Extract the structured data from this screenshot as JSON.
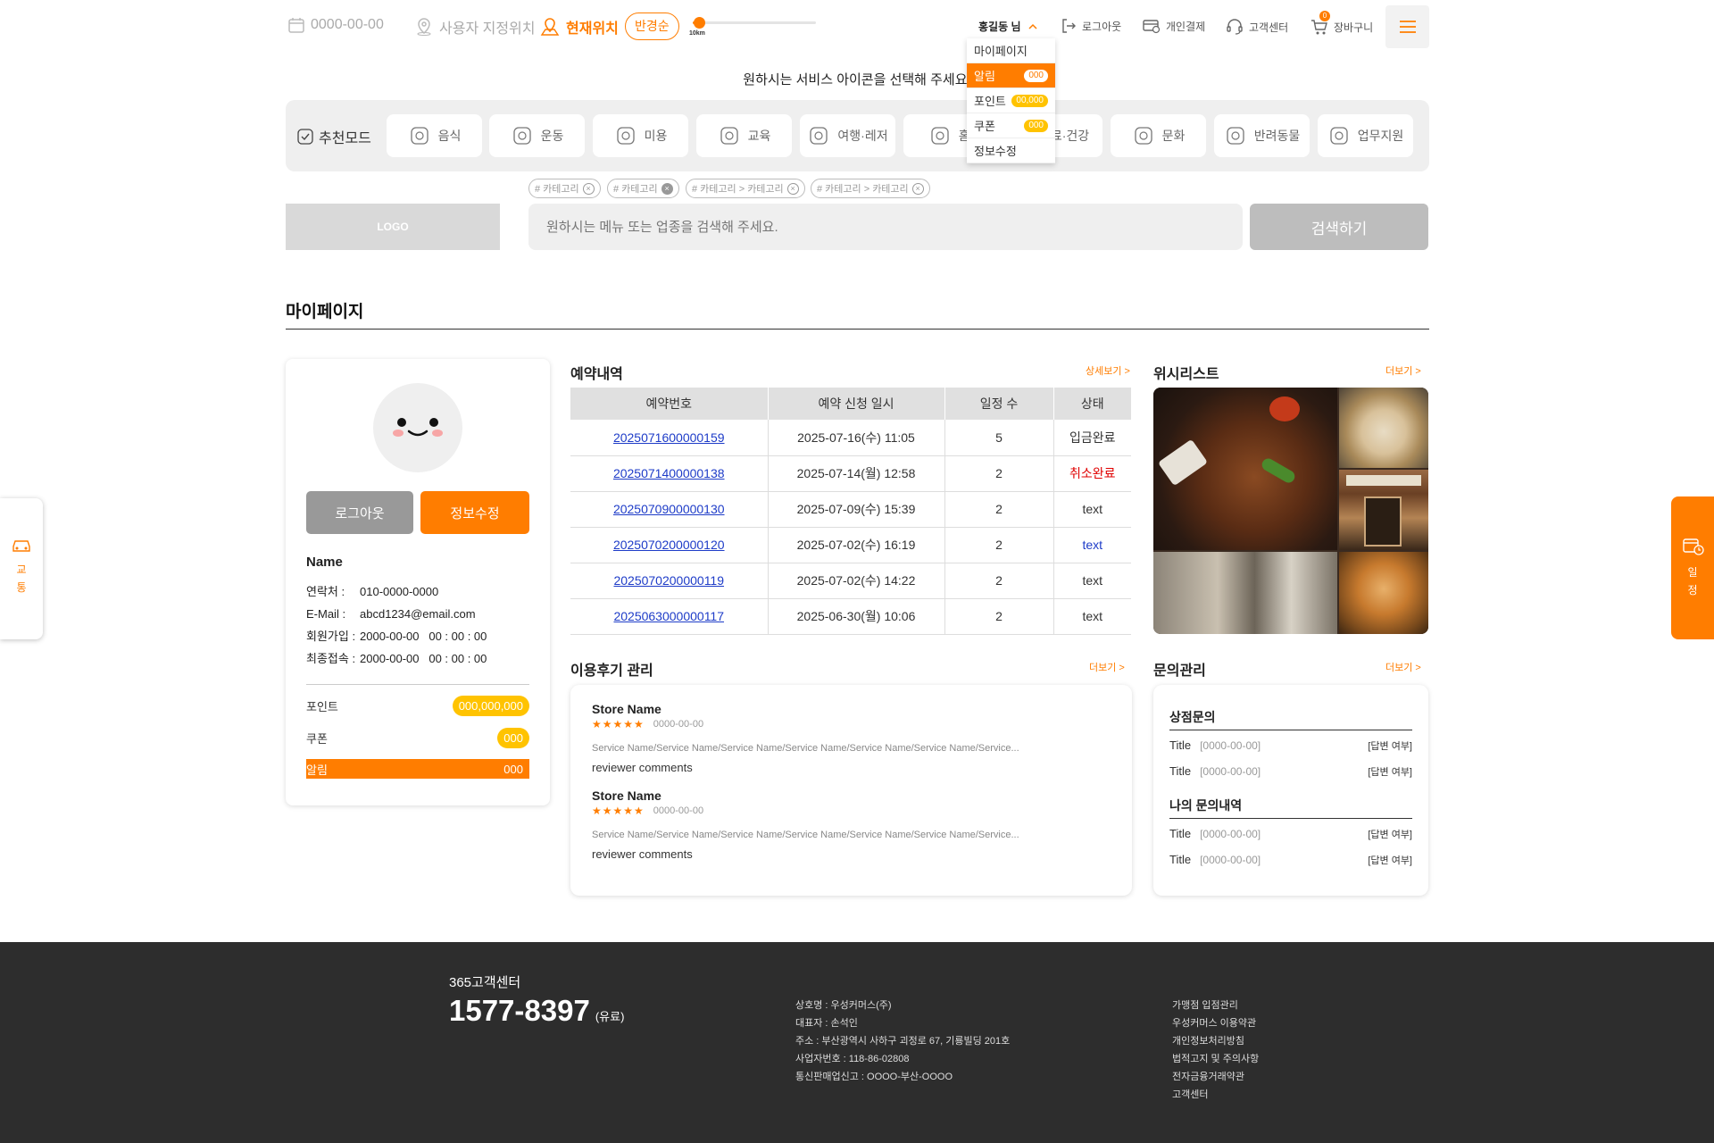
{
  "header": {
    "date_placeholder": "0000-00-00",
    "custom_location": "사용자 지정위치",
    "current_location": "현재위치",
    "radius_button": "반경순",
    "slider_label": "10km",
    "slider_value_fraction": 0.05,
    "user_name": "홍길동 님",
    "logout": "로그아웃",
    "personal_payment": "개인결제",
    "customer_center": "고객센터",
    "cart": "장바구니",
    "cart_count": "0"
  },
  "user_menu": [
    {
      "label": "마이페이지",
      "badge": ""
    },
    {
      "label": "알림",
      "badge": "000"
    },
    {
      "label": "포인트",
      "badge": "00,000"
    },
    {
      "label": "쿠폰",
      "badge": "000"
    },
    {
      "label": "정보수정",
      "badge": ""
    }
  ],
  "prompt": "원하시는 서비스 아이콘을 선택해 주세요.",
  "categories": {
    "mode_label": "추천모드",
    "items": [
      "음식",
      "운동",
      "미용",
      "교육",
      "여행·레저",
      "홈서비스",
      "의료·건강",
      "문화",
      "반려동물",
      "업무지원"
    ],
    "items_visible": [
      "음식",
      "운동",
      "미용",
      "교육",
      "여행·레저",
      "홈·",
      "료·건강",
      "문화",
      "반려동물",
      "업무지원"
    ]
  },
  "tags": [
    "# 카테고리",
    "# 카테고리",
    "# 카테고리 > 카테고리",
    "# 카테고리 > 카테고리"
  ],
  "search": {
    "logo": "LOGO",
    "placeholder": "원하시는 메뉴 또는 업종을 검색해 주세요.",
    "button": "검색하기"
  },
  "page_title": "마이페이지",
  "profile": {
    "logout": "로그아웃",
    "edit": "정보수정",
    "name": "Name",
    "fields": [
      {
        "label": "연락처 :",
        "value": "010-0000-0000"
      },
      {
        "label": "E-Mail :",
        "value": "abcd1234@email.com"
      },
      {
        "label": "회원가입 :",
        "value": "2000-00-00   00 : 00 : 00"
      },
      {
        "label": "최종접속 :",
        "value": "2000-00-00   00 : 00 : 00"
      }
    ],
    "points_label": "포인트",
    "points_value": "000,000,000",
    "coupon_label": "쿠폰",
    "coupon_value": "000",
    "alert_label": "알림",
    "alert_value": "000"
  },
  "reservations": {
    "title": "예약내역",
    "more": "상세보기 >",
    "columns": [
      "예약번호",
      "예약 신청 일시",
      "일정 수",
      "상태"
    ],
    "rows": [
      {
        "id": "2025071600000159",
        "date": "2025-07-16(수) 11:05",
        "count": "5",
        "status": "입금완료",
        "status_color": "#333333"
      },
      {
        "id": "2025071400000138",
        "date": "2025-07-14(월) 12:58",
        "count": "2",
        "status": "취소완료",
        "status_color": "#e00000"
      },
      {
        "id": "2025070900000130",
        "date": "2025-07-09(수) 15:39",
        "count": "2",
        "status": "text",
        "status_color": "#333333"
      },
      {
        "id": "2025070200000120",
        "date": "2025-07-02(수) 16:19",
        "count": "2",
        "status": "text",
        "status_color": "#1e3cc8"
      },
      {
        "id": "2025070200000119",
        "date": "2025-07-02(수) 14:22",
        "count": "2",
        "status": "text",
        "status_color": "#333333"
      },
      {
        "id": "2025063000000117",
        "date": "2025-06-30(월) 10:06",
        "count": "2",
        "status": "text",
        "status_color": "#333333"
      }
    ]
  },
  "wishlist": {
    "title": "위시리스트",
    "more": "더보기 >"
  },
  "reviews": {
    "title": "이용후기 관리",
    "more": "더보기 >",
    "items": [
      {
        "store": "Store Name",
        "stars": "★★★★★",
        "date": "0000-00-00",
        "services": "Service Name/Service Name/Service Name/Service Name/Service Name/Service Name/Service...",
        "comment": "reviewer comments"
      },
      {
        "store": "Store Name",
        "stars": "★★★★★",
        "date": "0000-00-00",
        "services": "Service Name/Service Name/Service Name/Service Name/Service Name/Service Name/Service...",
        "comment": "reviewer comments"
      }
    ]
  },
  "inquiries": {
    "title": "문의관리",
    "more": "더보기 >",
    "store_title": "상점문의",
    "my_title": "나의 문의내역",
    "store_rows": [
      {
        "title": "Title",
        "date": "[0000-00-00]",
        "status": "[답변 여부]"
      },
      {
        "title": "Title",
        "date": "[0000-00-00]",
        "status": "[답변 여부]"
      }
    ],
    "my_rows": [
      {
        "title": "Title",
        "date": "[0000-00-00]",
        "status": "[답변 여부]"
      },
      {
        "title": "Title",
        "date": "[0000-00-00]",
        "status": "[답변 여부]"
      }
    ]
  },
  "side": {
    "left": "교통",
    "right": "일정"
  },
  "footer": {
    "center_label": "365고객센터",
    "phone": "1577-8397",
    "phone_note": "(유료)",
    "company": [
      "상호명 : 우성커머스(주)",
      "대표자 : 손석인",
      "주소 : 부산광역시 사하구 괴정로 67, 기룡빌딩 201호",
      "사업자번호 : 118-86-02808",
      "통신판매업신고 : OOOO-부산-OOOO"
    ],
    "links": [
      "가맹점 입점관리",
      "우성커머스 이용약관",
      "개인정보처리방침",
      "법적고지 및 주의사항",
      "전자금융거래약관",
      "고객센터"
    ]
  },
  "colors": {
    "accent": "#ff7d00",
    "badge": "#ffc300",
    "link": "#1e3cc8",
    "footer_bg": "#2d2d2d"
  }
}
